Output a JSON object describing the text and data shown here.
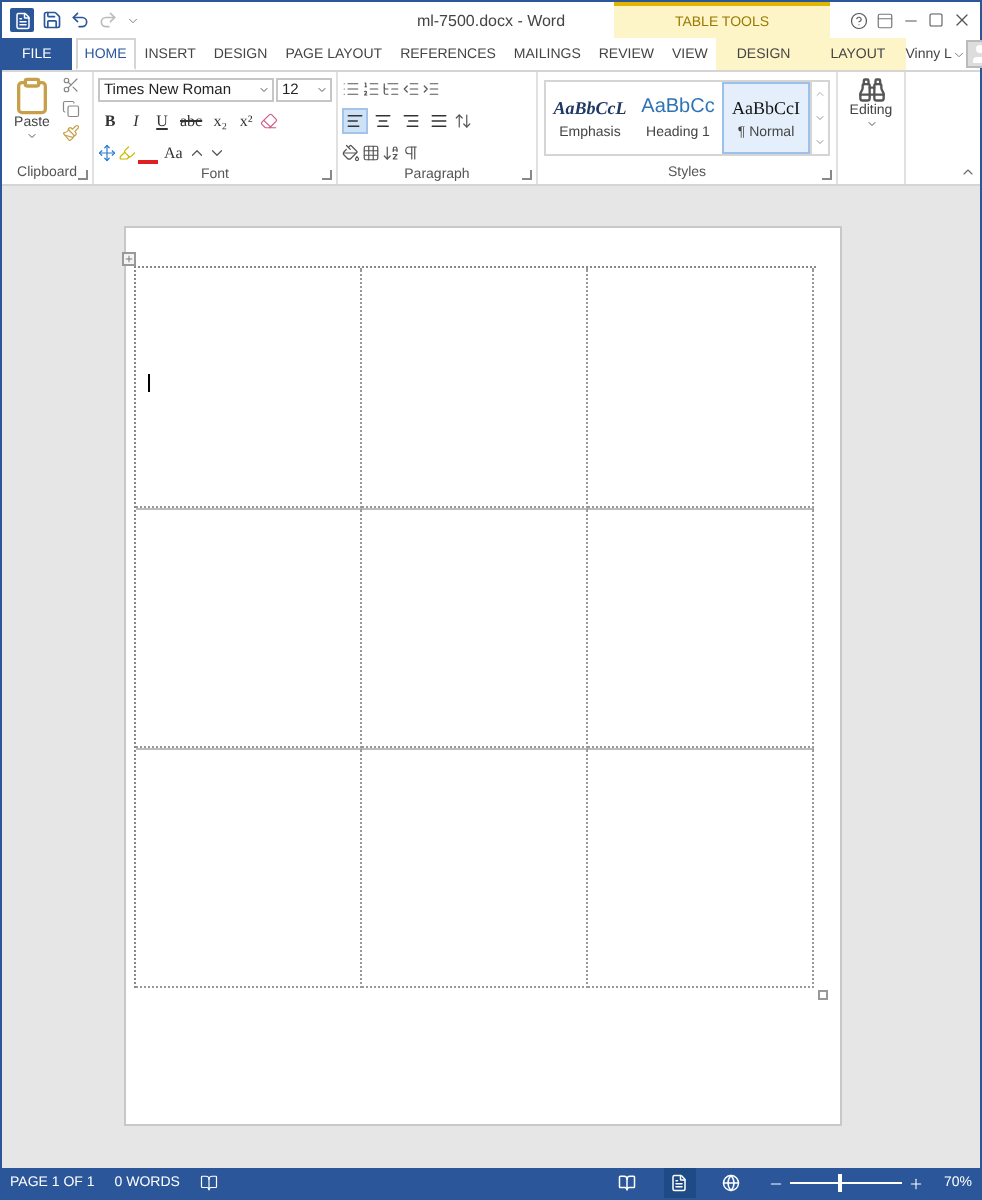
{
  "window": {
    "title": "ml-7500.docx - Word",
    "contextual_title": "TABLE TOOLS",
    "user": "Vinny L",
    "quick_access": [
      {
        "kind": "save",
        "disabled": false
      },
      {
        "kind": "undo",
        "disabled": false
      },
      {
        "kind": "redo",
        "disabled": true
      }
    ]
  },
  "tabs": [
    {
      "label": "FILE",
      "kind": "file",
      "selected": false
    },
    {
      "label": "HOME",
      "kind": "normal",
      "selected": true
    },
    {
      "label": "INSERT",
      "kind": "normal",
      "selected": false
    },
    {
      "label": "DESIGN",
      "kind": "normal",
      "selected": false
    },
    {
      "label": "PAGE LAYOUT",
      "kind": "normal",
      "selected": false
    },
    {
      "label": "REFERENCES",
      "kind": "normal",
      "selected": false
    },
    {
      "label": "MAILINGS",
      "kind": "normal",
      "selected": false
    },
    {
      "label": "REVIEW",
      "kind": "normal",
      "selected": false
    },
    {
      "label": "VIEW",
      "kind": "normal",
      "selected": false
    },
    {
      "label": "DESIGN",
      "kind": "contextual",
      "selected": false
    },
    {
      "label": "LAYOUT",
      "kind": "contextual",
      "selected": false
    }
  ],
  "ribbon": {
    "clipboard": {
      "paste": "Paste",
      "label": "Clipboard"
    },
    "font": {
      "name": "Times New Roman",
      "size": "12",
      "buttons": [
        "B",
        "I",
        "U",
        "abc",
        "x₂",
        "x²"
      ],
      "case_button": "Aa",
      "label": "Font"
    },
    "paragraph": {
      "label": "Paragraph",
      "alignment": [
        {
          "kind": "left",
          "selected": true
        },
        {
          "kind": "center",
          "selected": false
        },
        {
          "kind": "right",
          "selected": false
        },
        {
          "kind": "justify",
          "selected": false
        }
      ]
    },
    "styles": {
      "label": "Styles",
      "items": [
        {
          "preview": "AaBbCcL",
          "name": "Emphasis",
          "kind": "emphasis",
          "selected": false
        },
        {
          "preview": "AaBbCc",
          "name": "Heading 1",
          "kind": "heading",
          "selected": false
        },
        {
          "preview": "AaBbCcI",
          "name": "¶ Normal",
          "kind": "normal",
          "selected": true
        }
      ]
    },
    "editing": {
      "label": "Editing"
    }
  },
  "table": {
    "rows": [
      {
        "cells": [
          {
            "kind": "cursor"
          },
          {
            "kind": "empty"
          },
          {
            "kind": "empty"
          }
        ]
      },
      {
        "cells": [
          {
            "kind": "empty"
          },
          {
            "kind": "empty"
          },
          {
            "kind": "empty"
          }
        ]
      },
      {
        "cells": [
          {
            "kind": "empty"
          },
          {
            "kind": "empty"
          },
          {
            "kind": "empty"
          }
        ]
      }
    ]
  },
  "status_bar": {
    "page": "PAGE 1 OF 1",
    "words": "0 WORDS",
    "zoom": "70%",
    "zoom_level": {
      "level": 0.42
    },
    "views": [
      {
        "kind": "read",
        "selected": false
      },
      {
        "kind": "print",
        "selected": true
      },
      {
        "kind": "web",
        "selected": false
      }
    ]
  }
}
